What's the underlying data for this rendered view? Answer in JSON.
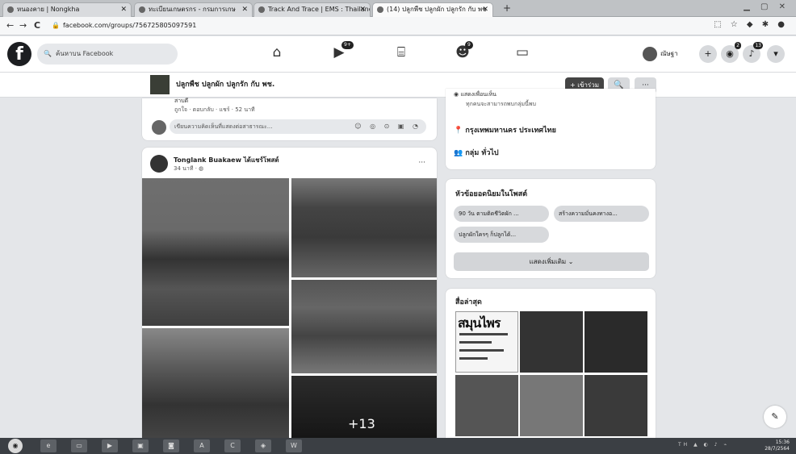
{
  "browser": {
    "tabs": [
      {
        "title": "หนองคาย | Nongkha",
        "active": false
      },
      {
        "title": "ทะเบียนเกษตรกร - กรมการเกษ",
        "active": false
      },
      {
        "title": "Track And Trace | EMS : Thailand",
        "active": false
      },
      {
        "title": "(14) ปลูกพืช ปลูกผัก ปลูกรัก กับ พช",
        "active": true
      }
    ],
    "new_tab_symbol": "+",
    "window_controls": "▁ ▢ ✕",
    "back_symbol": "←",
    "forward_symbol": "→",
    "reload_symbol": "C",
    "lock_symbol": "🔒",
    "url": "facebook.com/groups/756725805097591",
    "extension_icons": "⬚ ☆ ◆ ✱ ●"
  },
  "fb": {
    "logo_letter": "f",
    "search_placeholder": "ค้นหาบน Facebook",
    "search_icon": "🔍",
    "nav": [
      {
        "icon": "home-icon",
        "glyph": "⌂"
      },
      {
        "icon": "video-icon",
        "glyph": "▶",
        "badge": "9+"
      },
      {
        "icon": "marketplace-icon",
        "glyph": "⌸"
      },
      {
        "icon": "groups-icon",
        "glyph": "☻",
        "badge": "9"
      },
      {
        "icon": "gaming-icon",
        "glyph": "▭"
      }
    ],
    "profile_name": "ณัษฐา",
    "right_buttons": [
      {
        "icon": "plus-icon",
        "glyph": "+",
        "badge": ""
      },
      {
        "icon": "messenger-icon",
        "glyph": "◉",
        "badge": "2"
      },
      {
        "icon": "bell-icon",
        "glyph": "♪",
        "badge": "13"
      },
      {
        "icon": "caret-down-icon",
        "glyph": "▾",
        "badge": ""
      }
    ]
  },
  "group": {
    "name": "ปลูกพืช ปลูกผัก ปลูกรัก กับ พช.",
    "join_label": "+ เข้าร่วม",
    "search_glyph": "🔍",
    "more_glyph": "···"
  },
  "prev_post": {
    "line1": "สาบดี",
    "meta": "ถูกใจ · ตอบกลับ · แชร์ · 52 นาที",
    "comment_placeholder": "เขียนความคิดเห็นที่แสดงต่อสาธารณะ...",
    "comment_icons": "☺ ◎ ⊙ ▣ ◔"
  },
  "post": {
    "author": "Tonglank Buakaew ได้แชร์โพสต์",
    "time": "34 นาที · ◍",
    "more_glyph": "···",
    "more_photos": "+13"
  },
  "about": {
    "visible_title": "แสดงเพื่อนเห็น",
    "visible_desc": "ทุกคนจะสามารถพบกลุ่มนี้พบ",
    "location": "กรุงเทพมหานคร ประเทศไทย",
    "location_icon": "📍",
    "category": "กลุ่ม ทั่วไป",
    "category_icon": "👥"
  },
  "topics": {
    "title": "หัวข้อยอดนิยมในโพสต์",
    "chips": [
      "90 วัน ตามติดชีวิตผัก ...",
      "สร้างความมั่นคงทางอ...",
      "ปลูกผักใครๆ ก็ปลูกได้..."
    ],
    "see_more": "แสดงเพิ่มเติม ⌄"
  },
  "recent_media": {
    "title": "สื่อล่าสุด",
    "poster_text": "สมุนไพร"
  },
  "fab_glyph": "✎",
  "taskbar": {
    "start_glyph": "◉",
    "apps": [
      "e",
      "▭",
      "▶",
      "▣",
      "◙",
      "A",
      "C",
      "◈",
      "W"
    ],
    "tray": "TH ▲ ◐ ♪ ⌁",
    "time": "15:36",
    "date": "28/7/2564"
  }
}
